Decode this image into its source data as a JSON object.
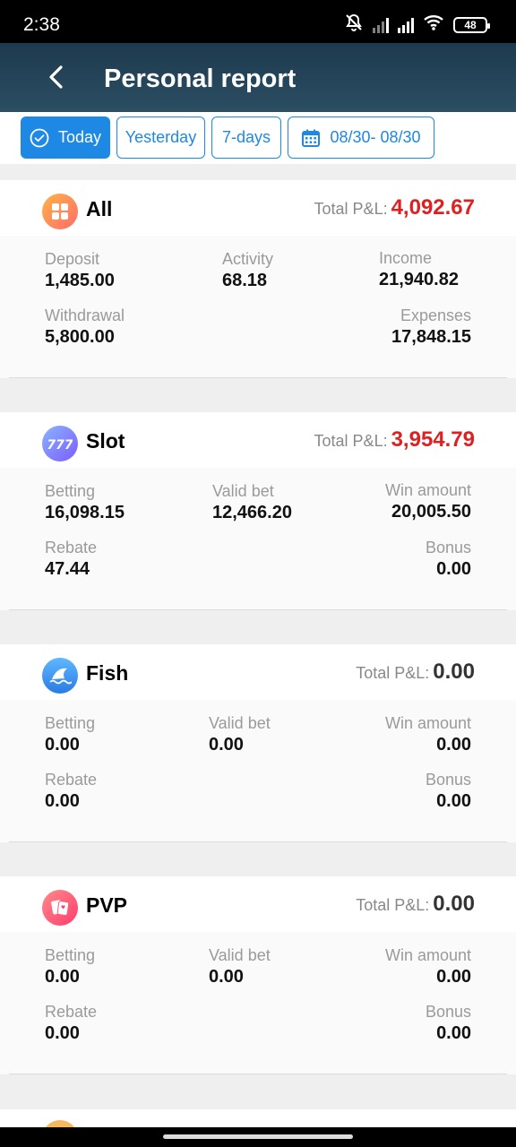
{
  "status_bar": {
    "time": "2:38",
    "battery": "48"
  },
  "header": {
    "title": "Personal report"
  },
  "filters": {
    "today": "Today",
    "yesterday": "Yesterday",
    "seven_days": "7-days",
    "date_range": "08/30- 08/30"
  },
  "total_label": "Total P&L:",
  "cards": [
    {
      "name": "All",
      "total": "4,092.67",
      "total_color": "#e02020",
      "row1": [
        {
          "label": "Deposit",
          "value": "1,485.00"
        },
        {
          "label": "Activity",
          "value": "68.18"
        },
        {
          "label": "Income",
          "value": "21,940.82"
        }
      ],
      "row2": [
        {
          "label": "Withdrawal",
          "value": "5,800.00"
        },
        {
          "label": "Expenses",
          "value": "17,848.15"
        }
      ]
    },
    {
      "name": "Slot",
      "total": "3,954.79",
      "total_color": "#e02020",
      "row1": [
        {
          "label": "Betting",
          "value": "16,098.15"
        },
        {
          "label": "Valid bet",
          "value": "12,466.20"
        },
        {
          "label": "Win amount",
          "value": "20,005.50"
        }
      ],
      "row2": [
        {
          "label": "Rebate",
          "value": "47.44"
        },
        {
          "label": "Bonus",
          "value": "0.00"
        }
      ]
    },
    {
      "name": "Fish",
      "total": "0.00",
      "total_color": "#333333",
      "row1": [
        {
          "label": "Betting",
          "value": "0.00"
        },
        {
          "label": "Valid bet",
          "value": "0.00"
        },
        {
          "label": "Win amount",
          "value": "0.00"
        }
      ],
      "row2": [
        {
          "label": "Rebate",
          "value": "0.00"
        },
        {
          "label": "Bonus",
          "value": "0.00"
        }
      ]
    },
    {
      "name": "PVP",
      "total": "0.00",
      "total_color": "#333333",
      "row1": [
        {
          "label": "Betting",
          "value": "0.00"
        },
        {
          "label": "Valid bet",
          "value": "0.00"
        },
        {
          "label": "Win amount",
          "value": "0.00"
        }
      ],
      "row2": [
        {
          "label": "Rebate",
          "value": "0.00"
        },
        {
          "label": "Bonus",
          "value": "0.00"
        }
      ]
    }
  ]
}
